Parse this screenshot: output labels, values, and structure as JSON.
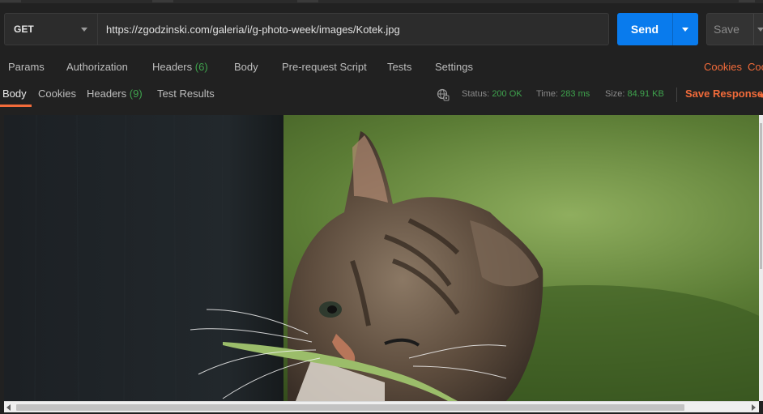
{
  "request": {
    "method": "GET",
    "url": "https://zgodzinski.com/galeria/i/g-photo-week/images/Kotek.jpg",
    "send_label": "Send",
    "save_label": "Save"
  },
  "request_tabs": {
    "params": "Params",
    "authorization": "Authorization",
    "headers": "Headers",
    "headers_count": "(6)",
    "body": "Body",
    "pre_request": "Pre-request Script",
    "tests": "Tests",
    "settings": "Settings",
    "cookies": "Cookies",
    "code": "Coc"
  },
  "response": {
    "tabs": {
      "body": "Body",
      "cookies": "Cookies",
      "headers": "Headers",
      "headers_count": "(9)",
      "test_results": "Test Results"
    },
    "status_label": "Status:",
    "status_value": "200 OK",
    "time_label": "Time:",
    "time_value": "283 ms",
    "size_label": "Size:",
    "size_value": "84.91 KB",
    "save_response": "Save Response"
  },
  "preview": {
    "subject": "kitten-photo"
  },
  "colors": {
    "accent": "#f26b3a",
    "send": "#097bed",
    "success": "#3fa34d"
  }
}
